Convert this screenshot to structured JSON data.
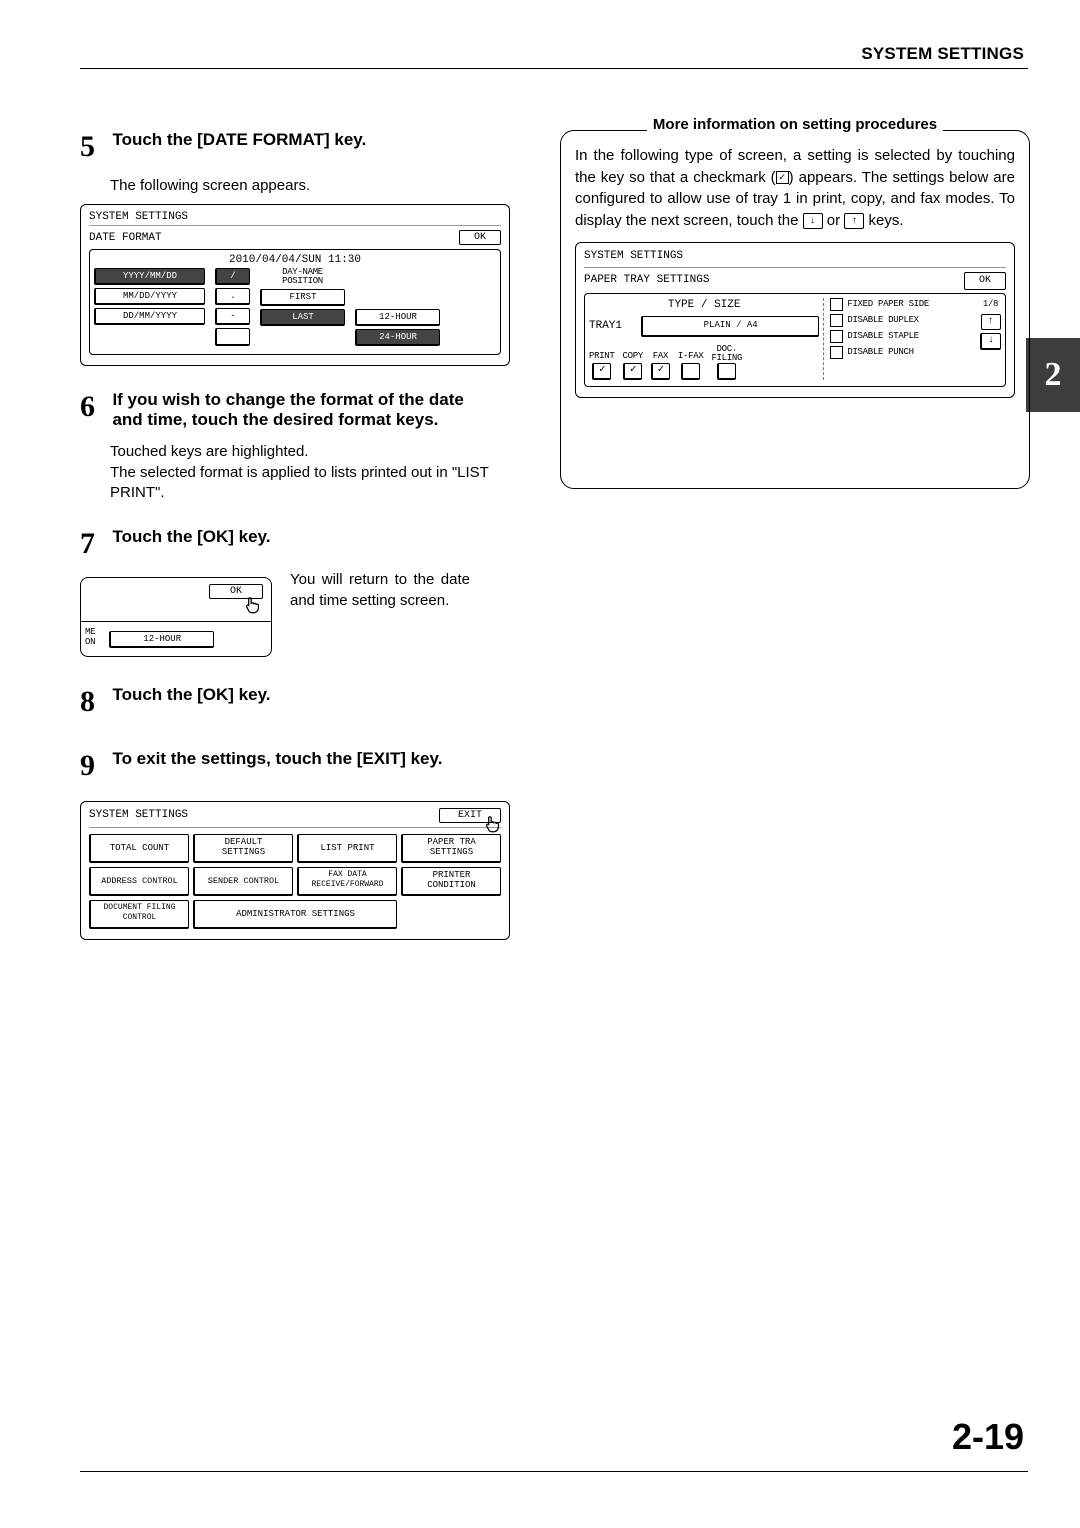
{
  "header": {
    "title": "SYSTEM SETTINGS"
  },
  "side_tab": {
    "label": "2"
  },
  "page_number": "2-19",
  "steps": {
    "s5": {
      "num": "5",
      "title": "Touch the [DATE FORMAT] key.",
      "body": "The following screen appears.",
      "screen": {
        "title": "SYSTEM SETTINGS",
        "subtitle": "DATE FORMAT",
        "ok": "OK",
        "datetime": "2010/04/04/SUN 11:30",
        "fmt1": "YYYY/MM/DD",
        "sep1": "/",
        "fmt2": "MM/DD/YYYY",
        "sep2": ".",
        "fmt3": "DD/MM/YYYY",
        "sep3": "-",
        "dayname": "DAY-NAME POSITION",
        "first": "FIRST",
        "last": "LAST",
        "h12": "12-HOUR",
        "h24": "24-HOUR"
      }
    },
    "s6": {
      "num": "6",
      "title": "If you wish to change the format of the date and time, touch the desired format keys.",
      "body1": "Touched keys are highlighted.",
      "body2": "The selected format is applied to lists printed out in \"LIST PRINT\"."
    },
    "s7": {
      "num": "7",
      "title": "Touch the [OK] key.",
      "aside": "You will return  to the date and time setting screen.",
      "screen": {
        "ok": "OK",
        "me": "ME",
        "on": "ON",
        "h12": "12-HOUR"
      }
    },
    "s8": {
      "num": "8",
      "title": "Touch the [OK] key."
    },
    "s9": {
      "num": "9",
      "title": "To exit the settings, touch the [EXIT] key.",
      "screen": {
        "title": "SYSTEM SETTINGS",
        "exit": "EXIT",
        "b1": "TOTAL COUNT",
        "b2": "DEFAULT SETTINGS",
        "b3": "LIST PRINT",
        "b4": "PAPER TRAY SETTINGS",
        "b5": "ADDRESS CONTROL",
        "b6": "SENDER CONTROL",
        "b7": "FAX DATA RECEIVE/FORWARD",
        "b8": "PRINTER CONDITION",
        "b9": "DOCUMENT FILING CONTROL",
        "b10": "ADMINISTRATOR SETTINGS"
      }
    }
  },
  "callout": {
    "title": "More information on setting procedures",
    "body_a": "In the following type of screen, a setting is selected by touching the key so that a checkmark (",
    "body_b": ") appears. The settings below are configured to allow use of tray 1 in print, copy, and fax modes. To display the next screen, touch the ",
    "body_c": " or ",
    "body_d": "  keys.",
    "screen": {
      "title": "SYSTEM SETTINGS",
      "subtitle": "PAPER TRAY SETTINGS",
      "ok": "OK",
      "type_size": "TYPE / SIZE",
      "tray1": "TRAY1",
      "plain": "PLAIN / A4",
      "print": "PRINT",
      "copy": "COPY",
      "fax": "FAX",
      "ifax": "I-FAX",
      "doc": "DOC. FILING",
      "opt1": "FIXED PAPER SIDE",
      "opt2": "DISABLE DUPLEX",
      "opt3": "DISABLE STAPLE",
      "opt4": "DISABLE PUNCH",
      "page": "1/8"
    }
  }
}
